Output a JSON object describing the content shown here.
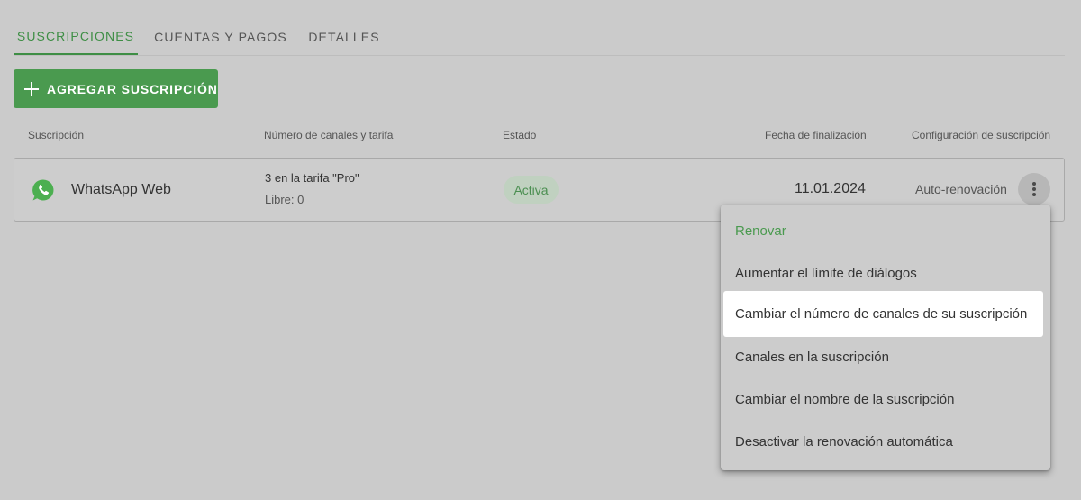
{
  "tabs": [
    {
      "label": "SUSCRIPCIONES",
      "active": true
    },
    {
      "label": "CUENTAS Y PAGOS",
      "active": false
    },
    {
      "label": "DETALLES",
      "active": false
    }
  ],
  "add_button": {
    "label": "AGREGAR SUSCRIPCIÓN",
    "icon": "plus-icon"
  },
  "table": {
    "headers": {
      "subscription": "Suscripción",
      "channels": "Número de canales y tarifa",
      "status": "Estado",
      "end_date": "Fecha de finalización",
      "config": "Configuración de suscripción"
    },
    "rows": [
      {
        "icon": "whatsapp-icon",
        "name": "WhatsApp Web",
        "channels": "3 en la tarifa \"Pro\"",
        "free": "Libre: 0",
        "status": "Activa",
        "end_date": "11.01.2024",
        "config": "Auto-renovación"
      }
    ]
  },
  "menu": {
    "items": [
      {
        "label": "Renovar"
      },
      {
        "label": "Aumentar el límite de diálogos"
      },
      {
        "label": "Cambiar el número de canales de su suscripción"
      },
      {
        "label": "Canales en la suscripción"
      },
      {
        "label": "Cambiar el nombre de la suscripción"
      },
      {
        "label": "Desactivar la renovación automática"
      }
    ]
  },
  "colors": {
    "accent": "#4a9a4f",
    "background": "#cbcbcb",
    "whatsapp": "#4caf50"
  }
}
